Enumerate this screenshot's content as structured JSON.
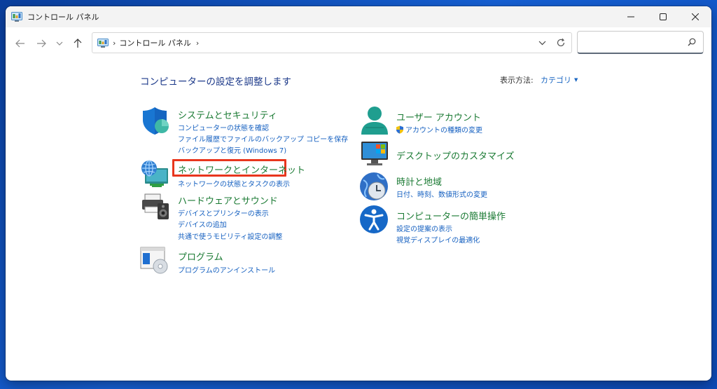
{
  "window": {
    "title": "コントロール パネル",
    "accent_color": "#0067c0"
  },
  "address_bar": {
    "path": "コントロール パネル",
    "separator": "›"
  },
  "search": {
    "placeholder": ""
  },
  "main": {
    "heading": "コンピューターの設定を調整します",
    "view_by_label": "表示方法:",
    "view_by_value": "カテゴリ"
  },
  "categories": {
    "system_security": {
      "title": "システムとセキュリティ",
      "icon": "shield-icon",
      "links": [
        "コンピューターの状態を確認",
        "ファイル履歴でファイルのバックアップ コピーを保存",
        "バックアップと復元 (Windows 7)"
      ]
    },
    "network": {
      "title": "ネットワークとインターネット",
      "icon": "network-globe-icon",
      "links": [
        "ネットワークの状態とタスクの表示"
      ],
      "highlight_color": "#e8361d"
    },
    "hardware": {
      "title": "ハードウェアとサウンド",
      "icon": "printer-speaker-icon",
      "links": [
        "デバイスとプリンターの表示",
        "デバイスの追加",
        "共通で使うモビリティ設定の調整"
      ]
    },
    "programs": {
      "title": "プログラム",
      "icon": "programs-disc-icon",
      "links": [
        "プログラムのアンインストール"
      ]
    },
    "user_accounts": {
      "title": "ユーザー アカウント",
      "icon": "user-icon",
      "links": [
        "アカウントの種類の変更"
      ]
    },
    "appearance": {
      "title": "デスクトップのカスタマイズ",
      "icon": "monitor-icon",
      "links": []
    },
    "clock_region": {
      "title": "時計と地域",
      "icon": "clock-globe-icon",
      "links": [
        "日付、時刻、数値形式の変更"
      ]
    },
    "ease_of_access": {
      "title": "コンピューターの簡単操作",
      "icon": "accessibility-icon",
      "links": [
        "設定の提案の表示",
        "視覚ディスプレイの最適化"
      ]
    }
  }
}
